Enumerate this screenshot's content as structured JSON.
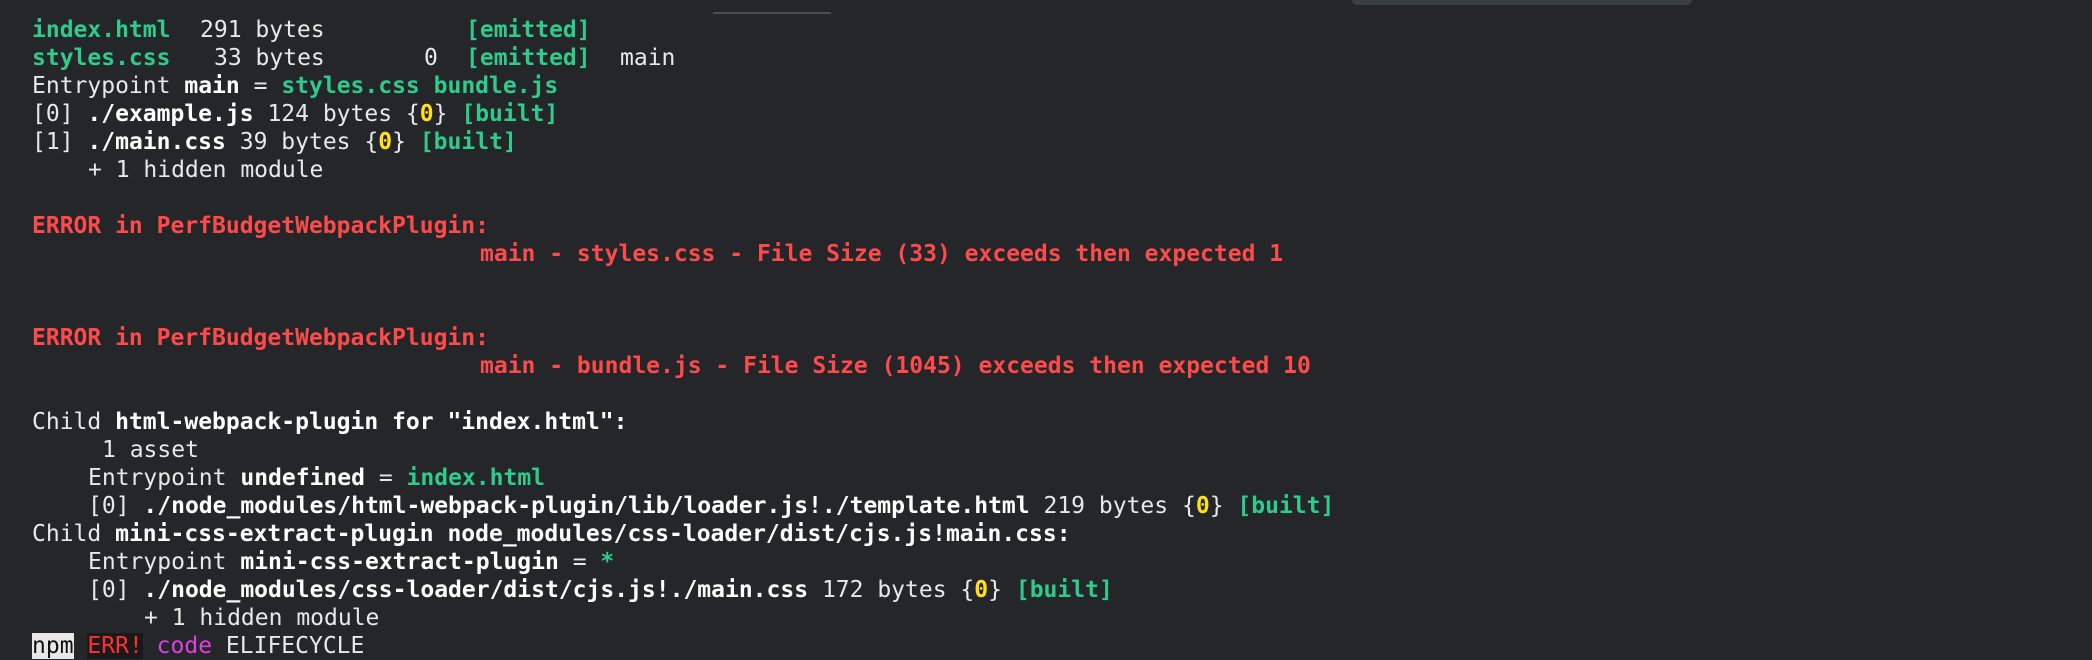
{
  "assets": [
    {
      "name": "index.html",
      "size": "291 bytes",
      "chunks": "",
      "status": "[emitted]",
      "chunk_names": ""
    },
    {
      "name": "styles.css",
      "size": "33 bytes",
      "chunks": "0",
      "status": "[emitted]",
      "chunk_names": "main"
    }
  ],
  "entrypoint": {
    "prefix": "Entrypoint",
    "name": "main",
    "eq": "=",
    "files": "styles.css bundle.js"
  },
  "modules": [
    {
      "id": "[0]",
      "path": "./example.js",
      "size": "124 bytes",
      "brace_open": "{",
      "chunk": "0",
      "brace_close": "}",
      "status": "[built]"
    },
    {
      "id": "[1]",
      "path": "./main.css",
      "size": "39 bytes",
      "brace_open": "{",
      "chunk": "0",
      "brace_close": "}",
      "status": "[built]"
    }
  ],
  "hidden_modules": "+ 1 hidden module",
  "errors": [
    {
      "title": "ERROR in PerfBudgetWebpackPlugin:",
      "message": "main - styles.css - File Size (33) exceeds then expected 1"
    },
    {
      "title": "ERROR in PerfBudgetWebpackPlugin:",
      "message": "main - bundle.js - File Size (1045) exceeds then expected 10"
    }
  ],
  "child_html": {
    "prefix": "Child",
    "name": "html-webpack-plugin for \"index.html\":",
    "assets": "1 asset",
    "entry_prefix": "Entrypoint",
    "entry_name": "undefined",
    "entry_eq": "=",
    "entry_file": "index.html",
    "module_id": "[0]",
    "module_path": "./node_modules/html-webpack-plugin/lib/loader.js!./template.html",
    "module_size": "219 bytes",
    "brace_open": "{",
    "chunk": "0",
    "brace_close": "}",
    "status": "[built]"
  },
  "child_css": {
    "prefix": "Child",
    "name": "mini-css-extract-plugin node_modules/css-loader/dist/cjs.js!main.css:",
    "entry_prefix": "Entrypoint",
    "entry_name": "mini-css-extract-plugin",
    "entry_eq": "=",
    "entry_file": "*",
    "module_id": "[0]",
    "module_path": "./node_modules/css-loader/dist/cjs.js!./main.css",
    "module_size": "172 bytes",
    "brace_open": "{",
    "chunk": "0",
    "brace_close": "}",
    "status": "[built]",
    "hidden": "+ 1 hidden module"
  },
  "npm_error": {
    "npm": "npm",
    "err": "ERR!",
    "code_label": "code",
    "code": "ELIFECYCLE"
  }
}
